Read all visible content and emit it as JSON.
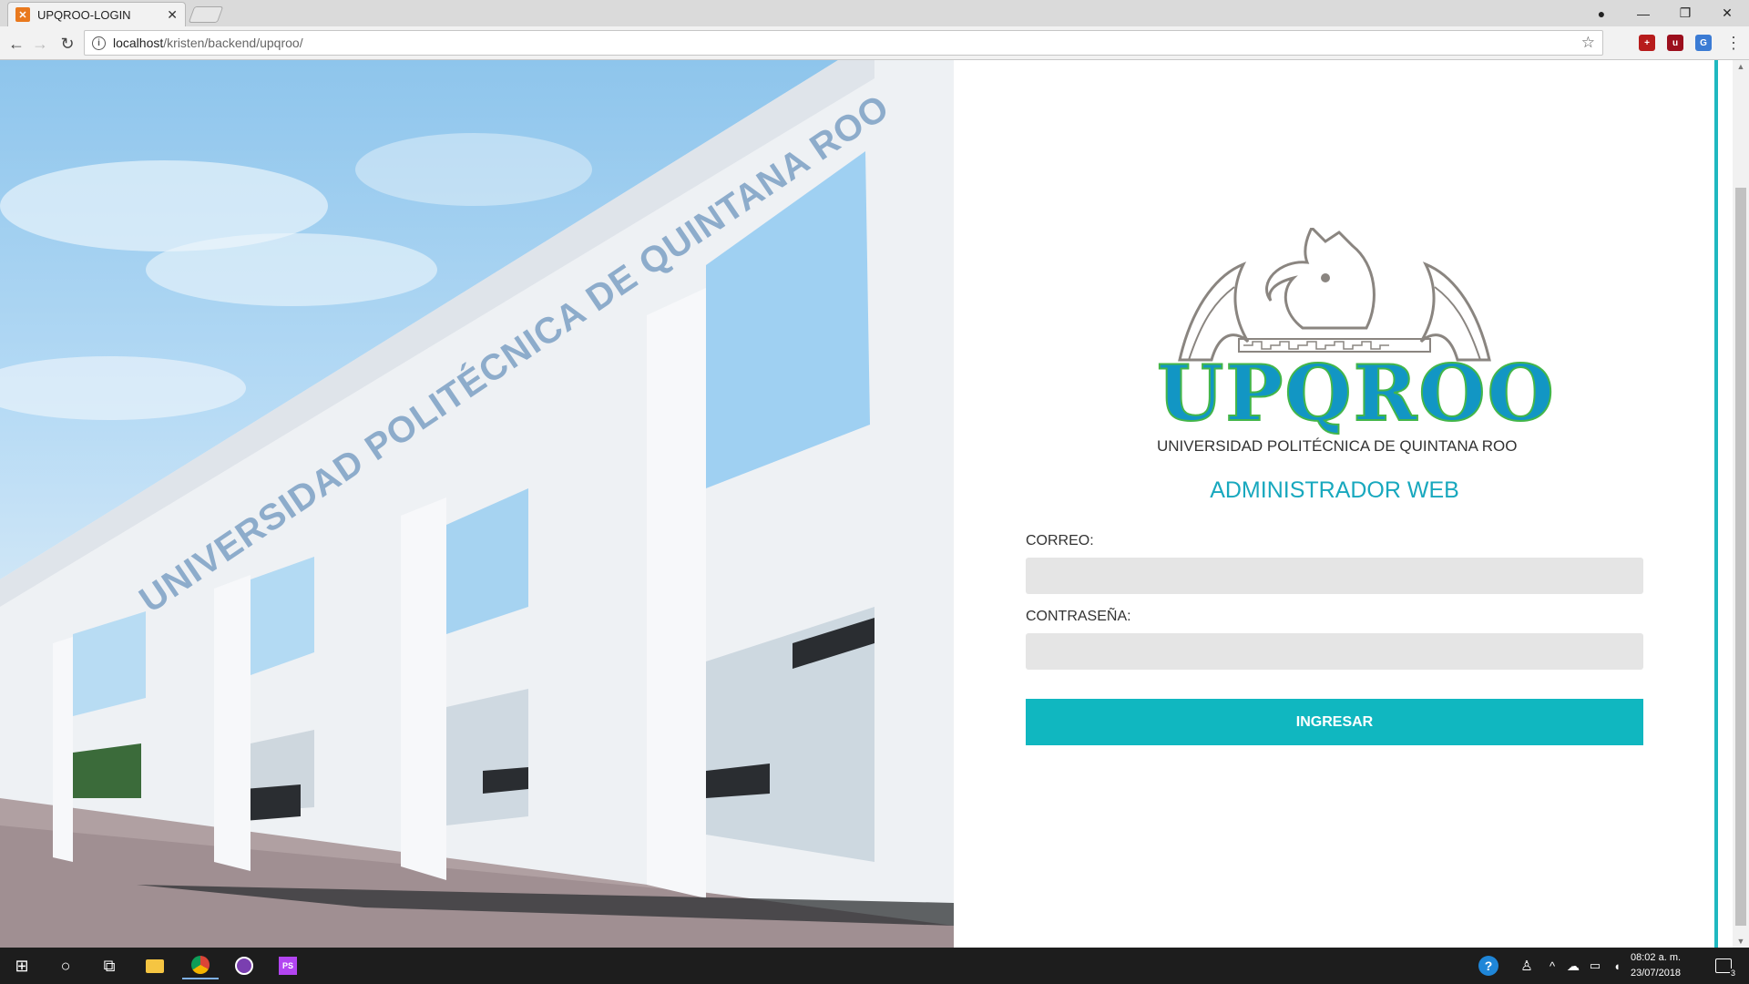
{
  "browser": {
    "tab_title": "UPQROO-LOGIN",
    "tab_close": "✕",
    "url_host": "localhost",
    "url_path": "/kristen/backend/upqroo/"
  },
  "hero": {
    "building_text": "UNIVERSIDAD POLITÉCNICA DE QUINTANA ROO"
  },
  "login": {
    "logo_wordmark": "UPQROO",
    "logo_subtitle": "UNIVERSIDAD POLITÉCNICA DE QUINTANA ROO",
    "heading": "ADMINISTRADOR WEB",
    "email_label": "CORREO:",
    "email_value": "",
    "password_label": "CONTRASEÑA:",
    "password_value": "",
    "submit_label": "INGRESAR"
  },
  "taskbar": {
    "time": "08:02 a. m.",
    "date": "23/07/2018",
    "notifications": "3"
  },
  "colors": {
    "accent": "#10b7c0",
    "heading": "#18a8be",
    "field_bg": "#e5e5e5",
    "logo_blue": "#1296c4",
    "logo_green": "#43b649",
    "logo_gray": "#8a8580"
  }
}
